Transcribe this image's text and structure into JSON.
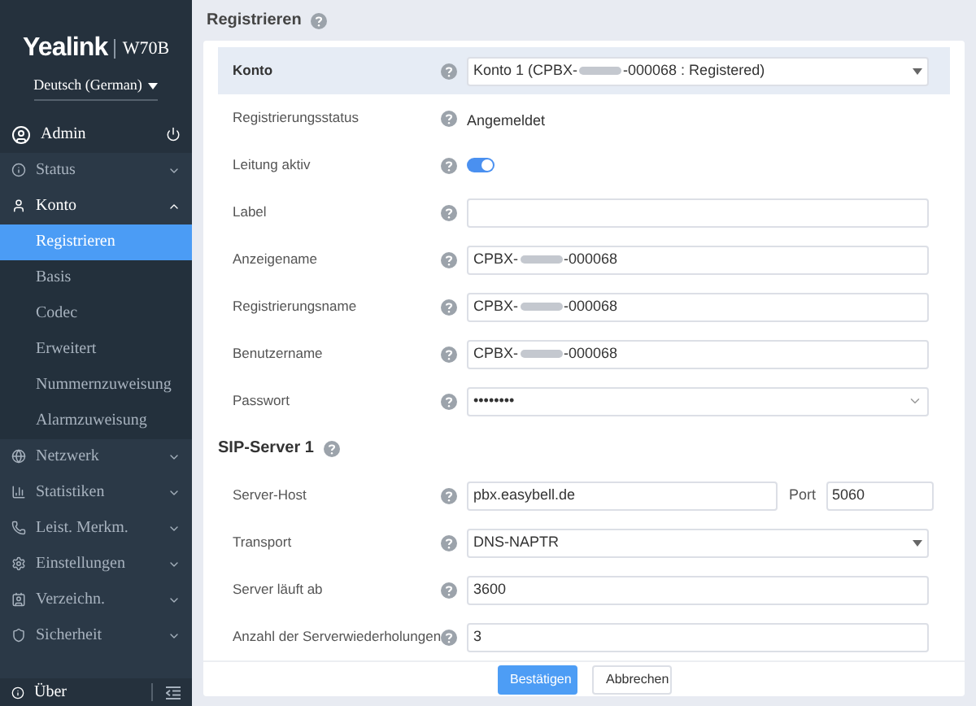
{
  "sidebar": {
    "logo": {
      "brand": "Yealink",
      "model": "W70B"
    },
    "language": "Deutsch (German)",
    "user": "Admin",
    "menu": [
      {
        "label": "Status",
        "expanded": false
      },
      {
        "label": "Konto",
        "expanded": true,
        "children": [
          {
            "label": "Registrieren",
            "selected": true
          },
          {
            "label": "Basis",
            "selected": false
          },
          {
            "label": "Codec",
            "selected": false
          },
          {
            "label": "Erweitert",
            "selected": false
          },
          {
            "label": "Nummernzuweisung",
            "selected": false
          },
          {
            "label": "Alarmzuweisung",
            "selected": false
          }
        ]
      },
      {
        "label": "Netzwerk",
        "expanded": false
      },
      {
        "label": "Statistiken",
        "expanded": false
      },
      {
        "label": "Leist. Merkm.",
        "expanded": false
      },
      {
        "label": "Einstellungen",
        "expanded": false
      },
      {
        "label": "Verzeichn.",
        "expanded": false
      },
      {
        "label": "Sicherheit",
        "expanded": false
      }
    ],
    "about": "Über"
  },
  "page": {
    "title": "Registrieren",
    "rows": [
      {
        "kind": "select",
        "label": "Konto",
        "highlighted": true,
        "value_prefix": "Konto 1 (CPBX-",
        "redacted": true,
        "value_suffix": "-000068 : Registered)"
      },
      {
        "kind": "status",
        "label": "Registrierungsstatus",
        "highlighted": false,
        "value": "Angemeldet"
      },
      {
        "kind": "toggle",
        "label": "Leitung aktiv",
        "highlighted": false,
        "on": true
      },
      {
        "kind": "text",
        "label": "Label",
        "highlighted": false,
        "value_prefix": "",
        "redacted": false,
        "value_suffix": ""
      },
      {
        "kind": "text",
        "label": "Anzeigename",
        "highlighted": false,
        "value_prefix": "CPBX-",
        "redacted": true,
        "value_suffix": "-000068"
      },
      {
        "kind": "text",
        "label": "Registrierungsname",
        "highlighted": false,
        "value_prefix": "CPBX-",
        "redacted": true,
        "value_suffix": "-000068"
      },
      {
        "kind": "text",
        "label": "Benutzername",
        "highlighted": false,
        "value_prefix": "CPBX-",
        "redacted": true,
        "value_suffix": "-000068"
      },
      {
        "kind": "password",
        "label": "Passwort",
        "highlighted": false,
        "value": "••••••••"
      },
      {
        "kind": "section",
        "label": "SIP-Server 1"
      },
      {
        "kind": "host_port",
        "label": "Server-Host",
        "highlighted": false,
        "value": "pbx.easybell.de",
        "port_label": "Port",
        "port": "5060"
      },
      {
        "kind": "select",
        "label": "Transport",
        "highlighted": false,
        "value_prefix": "DNS-NAPTR",
        "redacted": false,
        "value_suffix": ""
      },
      {
        "kind": "text",
        "label": "Server läuft ab",
        "highlighted": false,
        "value_prefix": "3600",
        "redacted": false,
        "value_suffix": ""
      },
      {
        "kind": "text",
        "label": "Anzahl der Serverwiederholungen",
        "highlighted": false,
        "value_prefix": "3",
        "redacted": false,
        "value_suffix": ""
      }
    ],
    "buttons": [
      {
        "label": "Bestätigen",
        "primary": true
      },
      {
        "label": "Abbrechen",
        "primary": false
      }
    ]
  }
}
